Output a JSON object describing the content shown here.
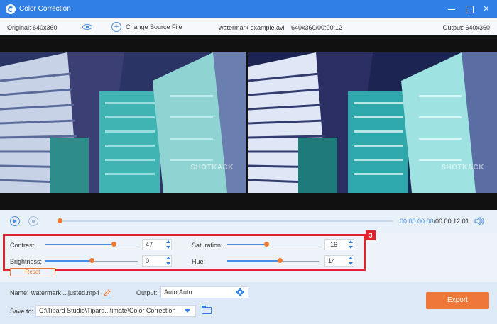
{
  "window": {
    "title": "Color Correction"
  },
  "info": {
    "original": "Original: 640x360",
    "change_source": "Change Source File",
    "file_name": "watermark example.avi",
    "file_time": "640x360/00:00:12",
    "output": "Output: 640x360"
  },
  "video": {
    "watermark": "SHOTKACK"
  },
  "playback": {
    "current_time": "00:00:00.00",
    "total_time": "/00:00:12.01",
    "progress": 0
  },
  "adjust": {
    "badge": "3",
    "contrast": {
      "label": "Contrast:",
      "value": "47",
      "level": 0.74
    },
    "saturation": {
      "label": "Saturation:",
      "value": "-16",
      "level": 0.42
    },
    "brightness": {
      "label": "Brightness:",
      "value": "0",
      "level": 0.5
    },
    "hue": {
      "label": "Hue:",
      "value": "14",
      "level": 0.57
    },
    "reset_label": "Reset"
  },
  "footer": {
    "name_label": "Name:",
    "name_value": "watermark ...justed.mp4",
    "output_label": "Output:",
    "output_value": "Auto;Auto",
    "save_label": "Save to:",
    "save_path": "C:\\Tipard Studio\\Tipard...timate\\Color Correction",
    "export_label": "Export"
  },
  "colors": {
    "title_bar": "#2f7fe6",
    "accent": "#4a8ee8",
    "handle": "#ee7a2f",
    "highlight_box": "#e0242f",
    "export": "#f0773a"
  }
}
